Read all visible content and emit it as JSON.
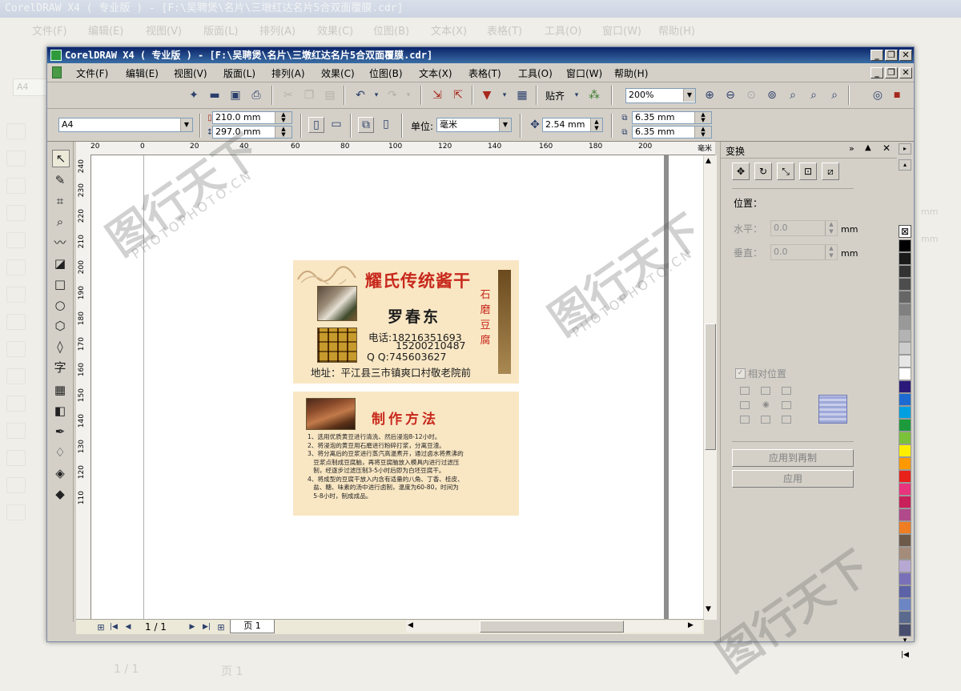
{
  "background_app": {
    "title": "CorelDRAW X4 ( 专业版 ) - [F:\\吴聘煲\\名片\\三墩红达名片5合双面覆膜.cdr]",
    "menu": [
      "文件(F)",
      "编辑(E)",
      "视图(V)",
      "版面(L)",
      "排列(A)",
      "效果(C)",
      "位图(B)",
      "文本(X)",
      "表格(T)",
      "工具(O)",
      "窗口(W)",
      "帮助(H)"
    ],
    "paper_size": "A4",
    "page_counter": "1 / 1",
    "page_tab": "页 1",
    "mm_label": "mm"
  },
  "window": {
    "title": "CorelDRAW X4 ( 专业版 ) - [F:\\吴聘煲\\名片\\三墩红达名片5合双面覆膜.cdr]",
    "controls": [
      "_",
      "❐",
      "✕"
    ]
  },
  "menu": [
    {
      "label": "文件(F)"
    },
    {
      "label": "编辑(E)"
    },
    {
      "label": "视图(V)"
    },
    {
      "label": "版面(L)"
    },
    {
      "label": "排列(A)"
    },
    {
      "label": "效果(C)"
    },
    {
      "label": "位图(B)"
    },
    {
      "label": "文本(X)"
    },
    {
      "label": "表格(T)"
    },
    {
      "label": "工具(O)"
    },
    {
      "label": "窗口(W)"
    },
    {
      "label": "帮助(H)"
    }
  ],
  "toolbar": {
    "paste_label": "贴齐",
    "zoom": "200%"
  },
  "property_bar": {
    "paper": "A4",
    "width": "210.0 mm",
    "height": "297.0 mm",
    "unit_label": "单位:",
    "unit": "毫米",
    "nudge": "2.54 mm",
    "dup_x": "6.35 mm",
    "dup_y": "6.35 mm"
  },
  "ruler": {
    "h_ticks": [
      "20",
      "0",
      "20",
      "40",
      "60",
      "80",
      "100",
      "120",
      "140",
      "160",
      "180",
      "200"
    ],
    "h_unit": "毫米",
    "v_ticks": [
      "240",
      "230",
      "220",
      "210",
      "200",
      "190",
      "180",
      "170",
      "160",
      "150",
      "140",
      "130",
      "120",
      "110"
    ]
  },
  "card_front": {
    "title": "耀氏传统酱干",
    "name": "罗春东",
    "side_text": "石磨豆腐",
    "tel_label": "电话:18216351693",
    "tel2": "15200210487",
    "qq": "Q Q:745603627",
    "address": "地址：平江县三市镇爽口村敬老院前"
  },
  "card_back": {
    "title": "制作方法",
    "steps": [
      "1、选用优质黄豆进行清洗、然后浸泡8-12小时。",
      "2、将浸泡的黄豆用石磨进行粉碎打浆，分离豆渣。",
      "3、将分离后的豆浆进行蒸汽高温煮开，通过卤水将煮沸的",
      "   豆浆点制成豆腐脑，再将豆腐脑放入模具内进行过滤压",
      "   制，经逐步过滤压制3-5小时后即为白坯豆腐干。",
      "4、将成型的豆腐干放入内含有适量的八角、丁香、桂皮、",
      "   盐、糖、味素的汤中进行卤制，温度为60-80，时间为",
      "   5-8小时，制成成品。"
    ]
  },
  "docker": {
    "title": "变换",
    "position_label": "位置：",
    "h_label": "水平：",
    "h_value": "0.0",
    "v_label": "垂直：",
    "v_value": "0.0",
    "unit": "mm",
    "relative_label": "相对位置",
    "apply_dup": "应用到再制",
    "apply": "应用"
  },
  "statusbar": {
    "page_counter": "1 / 1",
    "page_tab": "页 1"
  },
  "palette_colors": [
    "#000000",
    "#1a1a1a",
    "#333333",
    "#4d4d4d",
    "#666666",
    "#808080",
    "#999999",
    "#b3b3b3",
    "#cccccc",
    "#e6e6e6",
    "#ffffff",
    "#2b1a7a",
    "#1d6bd1",
    "#00a0e0",
    "#1d9b3c",
    "#7cc13a",
    "#ffee00",
    "#ff9900",
    "#e8211b",
    "#e8337d",
    "#c8205a",
    "#b04a8a",
    "#ef7d22",
    "#6e5a4a",
    "#a58c7a",
    "#b7a8d3",
    "#7a70b8",
    "#5b63a6",
    "#6c86c4",
    "#5a6a8e",
    "#484e6e"
  ],
  "watermark": {
    "logo": "图行天下",
    "url": "PHOTOPHOTO.CN"
  }
}
